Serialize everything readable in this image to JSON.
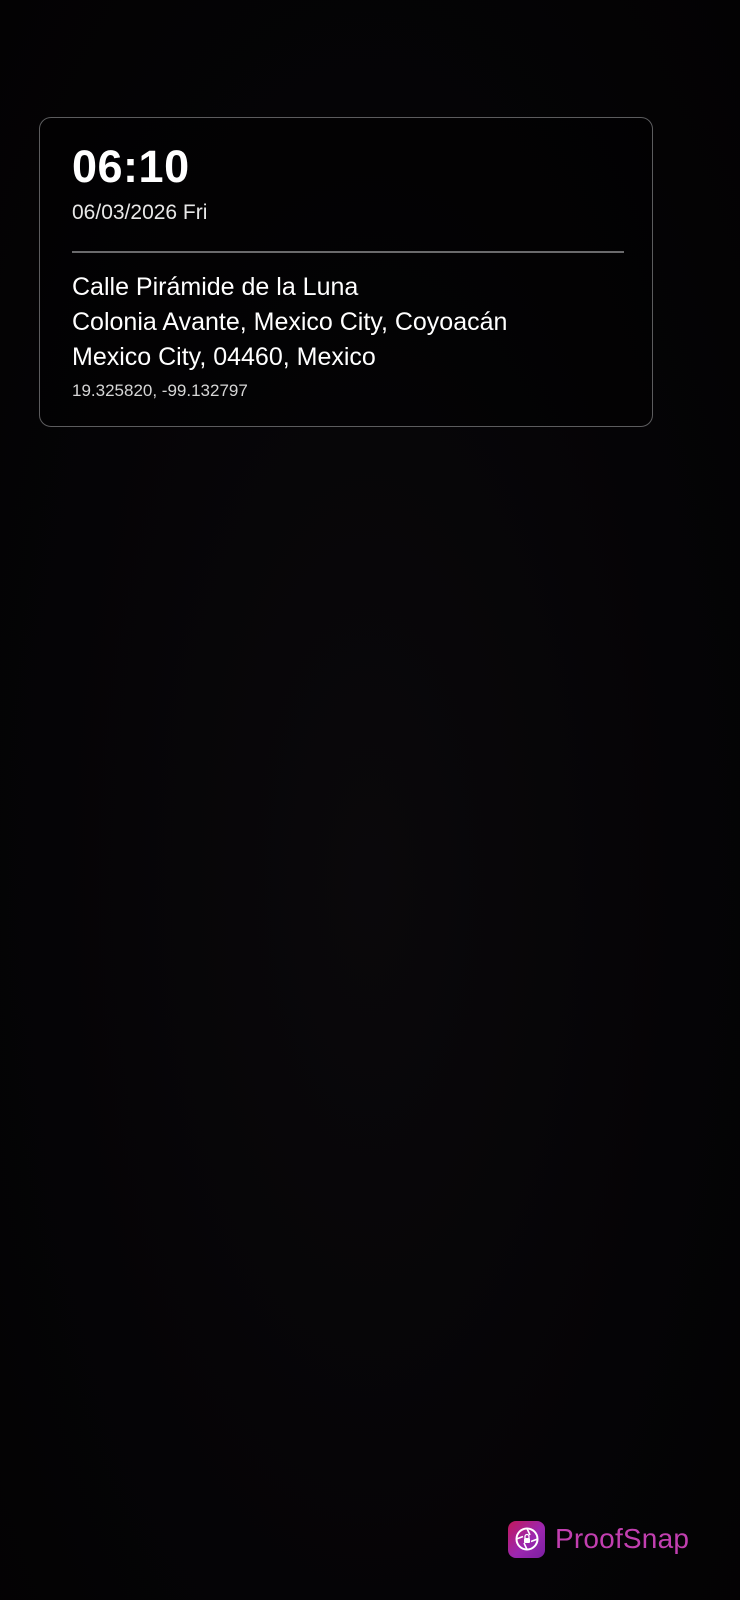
{
  "stamp": {
    "time": "06:10",
    "date": "06/03/2026 Fri",
    "address_lines": [
      "Calle Pirámide de la Luna",
      "Colonia Avante, Mexico City, Coyoacán",
      "Mexico City, 04460, Mexico"
    ],
    "coordinates": "19.325820, -99.132797"
  },
  "brand": {
    "name": "ProofSnap",
    "icon": "proofsnap-logo-icon",
    "color": "#c23fb0"
  },
  "colors": {
    "background": "#050406",
    "card_border": "#5c5c5e",
    "text": "#ffffff"
  }
}
